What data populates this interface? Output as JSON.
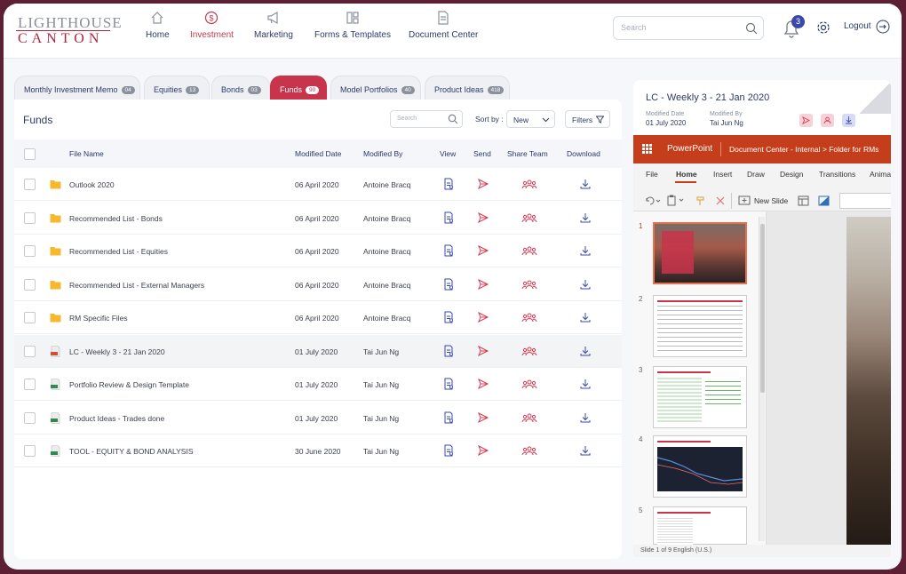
{
  "brand": {
    "line1": "LIGHTHOUSE",
    "line2": "CANTON"
  },
  "nav": [
    {
      "label": "Home",
      "icon": "home-icon"
    },
    {
      "label": "Investment",
      "icon": "dollar-icon",
      "active": true
    },
    {
      "label": "Marketing",
      "icon": "megaphone-icon"
    },
    {
      "label": "Forms & Templates",
      "icon": "forms-icon"
    },
    {
      "label": "Document Center",
      "icon": "document-icon"
    }
  ],
  "header": {
    "search_placeholder": "Search",
    "notifications": "3",
    "logout": "Logout"
  },
  "tabs": [
    {
      "label": "Monthly Investment Memo",
      "count": "04"
    },
    {
      "label": "Equities",
      "count": "13"
    },
    {
      "label": "Bonds",
      "count": "03"
    },
    {
      "label": "Funds",
      "count": "90",
      "active": true
    },
    {
      "label": "Model Portfolios",
      "count": "40"
    },
    {
      "label": "Product Ideas",
      "count": "418"
    }
  ],
  "panel": {
    "title": "Funds",
    "search_placeholder": "Search",
    "sort_label": "Sort by :",
    "sort_value": "New",
    "filters_label": "Filters"
  },
  "columns": {
    "file_name": "File Name",
    "modified_date": "Modified Date",
    "modified_by": "Modified By",
    "view": "View",
    "send": "Send",
    "share_team": "Share Team",
    "download": "Download"
  },
  "rows": [
    {
      "type": "folder",
      "name": "Outlook 2020",
      "date": "06 April 2020",
      "by": "Antoine Bracq"
    },
    {
      "type": "folder",
      "name": "Recommended List - Bonds",
      "date": "06 April 2020",
      "by": "Antoine Bracq"
    },
    {
      "type": "folder",
      "name": "Recommended List - Equities",
      "date": "06 April 2020",
      "by": "Antoine Bracq"
    },
    {
      "type": "folder",
      "name": "Recommended List - External Managers",
      "date": "06 April 2020",
      "by": "Antoine Bracq"
    },
    {
      "type": "folder",
      "name": "RM Specific Files",
      "date": "06 April 2020",
      "by": "Antoine Bracq"
    },
    {
      "type": "ppt",
      "name": "LC - Weekly 3 - 21 Jan 2020",
      "date": "01 July 2020",
      "by": "Tai Jun Ng",
      "highlight": true
    },
    {
      "type": "xls",
      "name": "Portfolio Review & Design Template",
      "date": "01 July 2020",
      "by": "Tai Jun Ng"
    },
    {
      "type": "xls",
      "name": "Product Ideas - Trades done",
      "date": "01 July 2020",
      "by": "Tai Jun Ng"
    },
    {
      "type": "xls",
      "name": "TOOL - EQUITY & BOND ANALYSIS",
      "date": "30 June 2020",
      "by": "Tai Jun Ng"
    }
  ],
  "viewer": {
    "title": "LC - Weekly 3 - 21 Jan 2020",
    "modified_date_label": "Modified Date",
    "modified_date": "01 July 2020",
    "modified_by_label": "Modified By",
    "modified_by": "Tai Jun Ng",
    "app": "PowerPoint",
    "breadcrumb": "Document Center - Internal  >  Folder for RMs",
    "ribbon_tabs": [
      "File",
      "Home",
      "Insert",
      "Draw",
      "Design",
      "Transitions",
      "Anima"
    ],
    "new_slide": "New Slide",
    "slide_numbers": [
      "1",
      "2",
      "3",
      "4",
      "5"
    ],
    "status": "Slide 1 of 9     English (U.S.)"
  },
  "colors": {
    "accent": "#c8344b",
    "navy": "#2d3a66",
    "powerpoint": "#c43e1c",
    "folder": "#f5b82e"
  }
}
